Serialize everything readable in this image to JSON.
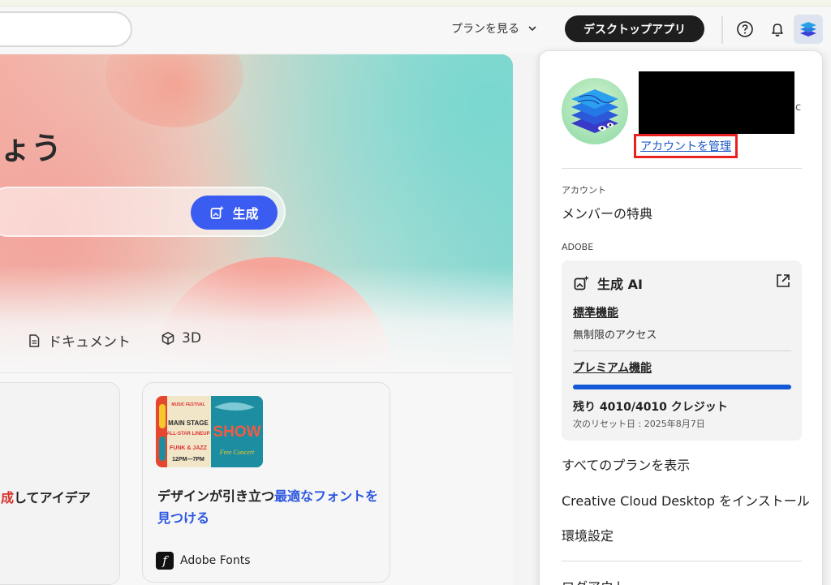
{
  "header": {
    "plans_label": "プランを見る",
    "desktop_app_label": "デスクトップアプリ",
    "help_icon": "help-icon",
    "bell_icon": "bell-icon"
  },
  "hero": {
    "title": "ょう",
    "generate_label": "生成",
    "categories": [
      {
        "label": "ドキュメント",
        "icon": "document-icon"
      },
      {
        "label": "3D",
        "icon": "cube-icon"
      }
    ]
  },
  "cards": [
    {
      "title_red": "成",
      "title_rest": "してアイデア"
    },
    {
      "title_normal": "デザインが引き立つ",
      "title_blue": "最適なフォントを見つける",
      "brand": "Adobe Fonts",
      "brand_badge": "f",
      "thumb": {
        "line1": "MUSIC FESTIVAL",
        "line2": "MAIN STAGE",
        "line3": "ALL-STAR LINEUP",
        "line4": "FUNK & JAZZ",
        "line5": "12PM—7PM",
        "show": "SHOW",
        "concert": "Free Concert"
      }
    }
  ],
  "account_panel": {
    "redacted_tail": "c",
    "manage_account": "アカウントを管理",
    "account_section_label": "アカウント",
    "member_benefits": "メンバーの特典",
    "adobe_section_label": "ADOBE",
    "genai": {
      "title": "生成 AI",
      "standard_heading": "標準機能",
      "standard_desc": "無制限のアクセス",
      "premium_heading": "プレミアム機能",
      "progress_fraction": 1.0,
      "credits": "残り 4010/4010 クレジット",
      "reset": "次のリセット日 : 2025年8月7日"
    },
    "all_plans": "すべてのプランを表示",
    "install_ccd": "Creative Cloud Desktop をインストール",
    "preferences": "環境設定",
    "logout": "ログアウト"
  },
  "colors": {
    "accent_blue": "#3b5cf0",
    "link_blue": "#1a56c7",
    "highlight_red": "#e8231f",
    "progress_blue": "#1358d6"
  }
}
